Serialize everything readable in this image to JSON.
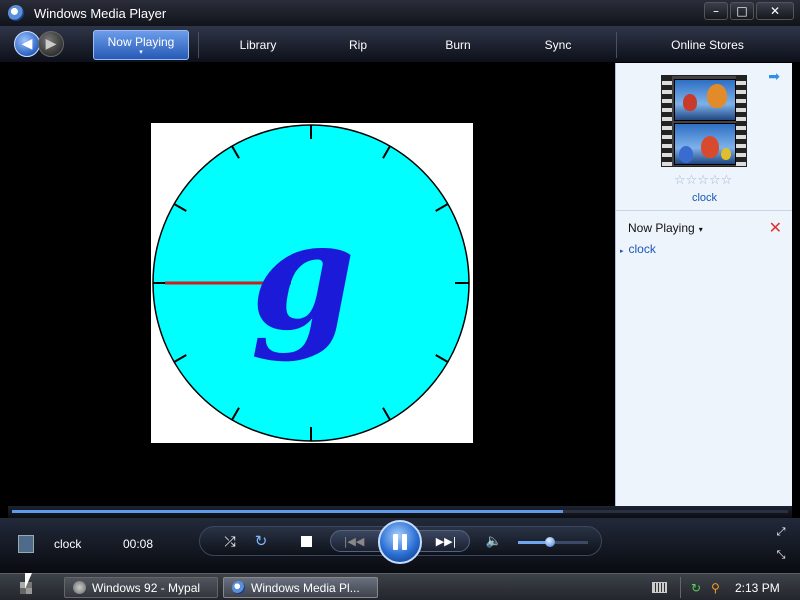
{
  "window": {
    "title": "Windows Media Player",
    "minimize_glyph": "–",
    "maximize_glyph": "□",
    "close_glyph": "✕"
  },
  "nav": {
    "back_glyph": "◀",
    "forward_glyph": "▶",
    "tabs": [
      "Now Playing",
      "Library",
      "Rip",
      "Burn",
      "Sync",
      "Online Stores"
    ],
    "active_caret": "▾"
  },
  "video": {
    "clock_face_color": "#00ffff",
    "hand_color": "#cc2020",
    "logo_color": "#1a1ad8",
    "logo_text": "g"
  },
  "panel": {
    "next_arrow": "➡",
    "stars": "☆☆☆☆☆",
    "album_caption": "clock",
    "now_playing_label": "Now Playing",
    "dropdown_caret": "▾",
    "clear_glyph": "✕",
    "playlist": [
      {
        "title": "clock",
        "marker": "▸"
      }
    ]
  },
  "seek": {
    "progress": 0.71
  },
  "controls": {
    "track_title": "clock",
    "elapsed": "00:08",
    "shuffle_glyph": "⤮",
    "repeat_glyph": "↻",
    "prev_glyph": "|◀◀",
    "next_glyph": "▶▶|",
    "mute_glyph": "🔈",
    "volume": 0.45,
    "fullscreen_glyph": "⤢",
    "mini_glyph": "⤡"
  },
  "taskbar": {
    "tasks": [
      {
        "label": "Windows 92 - Mypal"
      },
      {
        "label": "Windows Media Pl..."
      }
    ],
    "tray_net_glyph": "↻",
    "tray_search_glyph": "⚲",
    "clock": "2:13 PM"
  },
  "colors": {
    "accent": "#2659b5",
    "panel_bg": "#eef4fb",
    "link": "#1c56b8"
  }
}
